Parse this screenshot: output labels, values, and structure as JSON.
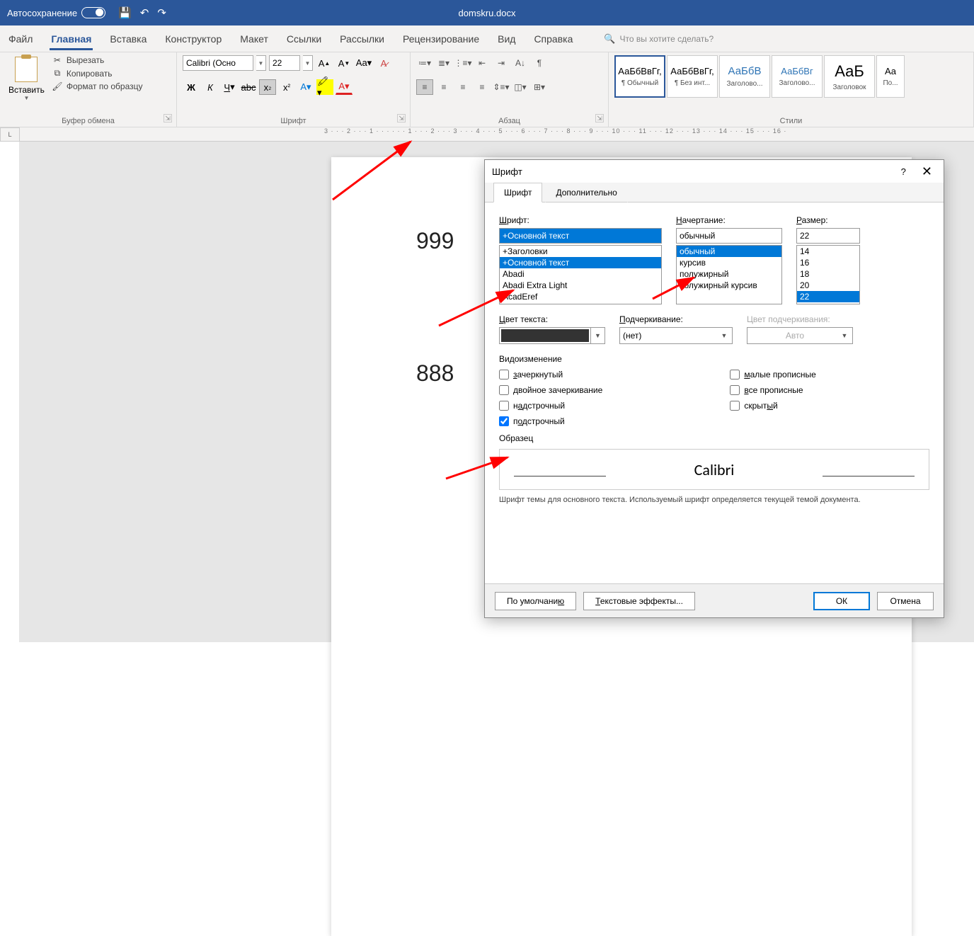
{
  "titlebar": {
    "autosave": "Автосохранение",
    "filename": "domskru.docx"
  },
  "tabs": {
    "file": "Файл",
    "home": "Главная",
    "insert": "Вставка",
    "design": "Конструктор",
    "layout": "Макет",
    "references": "Ссылки",
    "mailings": "Рассылки",
    "review": "Рецензирование",
    "view": "Вид",
    "help": "Справка",
    "tellme": "Что вы хотите сделать?"
  },
  "ribbon": {
    "clipboard": {
      "paste": "Вставить",
      "cut": "Вырезать",
      "copy": "Копировать",
      "formatpainter": "Формат по образцу",
      "group": "Буфер обмена"
    },
    "font": {
      "name": "Calibri (Осно",
      "size": "22",
      "group": "Шрифт"
    },
    "paragraph": {
      "group": "Абзац"
    },
    "styles": {
      "group": "Стили",
      "items": [
        {
          "sample": "АаБбВвГг,",
          "name": "¶ Обычный"
        },
        {
          "sample": "АаБбВвГг,",
          "name": "¶ Без инт..."
        },
        {
          "sample": "АаБбВ",
          "name": "Заголово..."
        },
        {
          "sample": "АаБбВг",
          "name": "Заголово..."
        },
        {
          "sample": "АаБ",
          "name": "Заголовок"
        }
      ],
      "more": "По..."
    }
  },
  "doc": {
    "t1": "999",
    "t2": "888"
  },
  "dialog": {
    "title": "Шрифт",
    "help": "?",
    "tab_font": "Шрифт",
    "tab_adv": "Дополнительно",
    "font_label": "Шрифт:",
    "font_val": "+Основной текст",
    "font_list": [
      "+Заголовки",
      "+Основной текст",
      "Abadi",
      "Abadi Extra Light",
      "AcadEref"
    ],
    "style_label": "Начертание:",
    "style_val": "обычный",
    "style_list": [
      "обычный",
      "курсив",
      "полужирный",
      "полужирный курсив"
    ],
    "size_label": "Размер:",
    "size_val": "22",
    "size_list": [
      "14",
      "16",
      "18",
      "20",
      "22"
    ],
    "color_label": "Цвет текста:",
    "underline_label": "Подчеркивание:",
    "underline_val": "(нет)",
    "ucolor_label": "Цвет подчеркивания:",
    "ucolor_val": "Авто",
    "effects_title": "Видоизменение",
    "eff": {
      "strike": "зачеркнутый",
      "dstrike": "двойное зачеркивание",
      "super": "надстрочный",
      "sub": "подстрочный",
      "smallcaps": "малые прописные",
      "allcaps": "все прописные",
      "hidden": "скрытый"
    },
    "sample_title": "Образец",
    "sample_text": "Calibri",
    "note": "Шрифт темы для основного текста. Используемый шрифт определяется текущей темой документа.",
    "btn_default": "По умолчанию",
    "btn_fx": "Текстовые эффекты...",
    "btn_ok": "ОК",
    "btn_cancel": "Отмена"
  },
  "ruler": {
    "h": "3 · · · 2 · · · 1 · · ·      · · · 1 · · · 2 · · · 3 · · · 4 · · · 5 · · · 6 · · · 7 · · · 8 · · · 9 · · · 10 · · · 11 · · · 12 · · · 13 · · · 14 · · · 15 · · · 16 ·"
  }
}
